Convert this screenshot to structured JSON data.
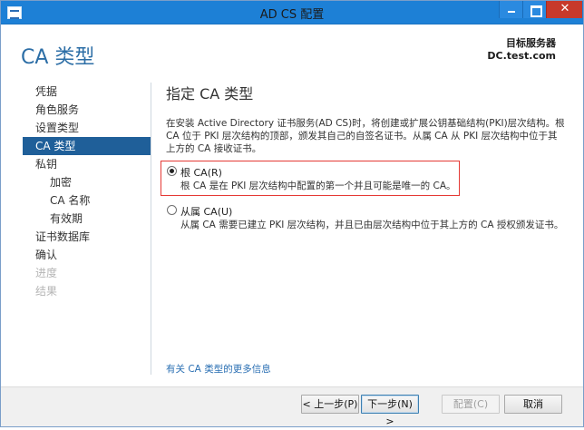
{
  "window": {
    "title": "AD CS 配置",
    "close_glyph": "✕"
  },
  "header": {
    "page_title": "CA 类型",
    "target_server_label": "目标服务器",
    "target_server_value": "DC.test.com"
  },
  "nav": {
    "items": [
      {
        "label": "凭据",
        "state": "normal",
        "level": 0
      },
      {
        "label": "角色服务",
        "state": "normal",
        "level": 0
      },
      {
        "label": "设置类型",
        "state": "normal",
        "level": 0
      },
      {
        "label": "CA 类型",
        "state": "selected",
        "level": 0
      },
      {
        "label": "私钥",
        "state": "normal",
        "level": 0
      },
      {
        "label": "加密",
        "state": "normal",
        "level": 1
      },
      {
        "label": "CA 名称",
        "state": "normal",
        "level": 1
      },
      {
        "label": "有效期",
        "state": "normal",
        "level": 1
      },
      {
        "label": "证书数据库",
        "state": "normal",
        "level": 0
      },
      {
        "label": "确认",
        "state": "normal",
        "level": 0
      },
      {
        "label": "进度",
        "state": "disabled",
        "level": 0
      },
      {
        "label": "结果",
        "state": "disabled",
        "level": 0
      }
    ]
  },
  "content": {
    "section_title": "指定 CA 类型",
    "description": "在安装 Active Directory 证书服务(AD CS)时，将创建或扩展公钥基础结构(PKI)层次结构。根 CA 位于 PKI 层次结构的顶部，颁发其自己的自签名证书。从属 CA 从 PKI 层次结构中位于其上方的 CA 接收证书。",
    "options": {
      "root": {
        "label": "根 CA(R)",
        "description": "根 CA 是在 PKI 层次结构中配置的第一个并且可能是唯一的 CA。",
        "selected": true
      },
      "subordinate": {
        "label": "从属 CA(U)",
        "description": "从属 CA 需要已建立 PKI 层次结构，并且已由层次结构中位于其上方的 CA 授权颁发证书。",
        "selected": false
      }
    },
    "more_info_link": "有关 CA 类型的更多信息"
  },
  "footer": {
    "prev_label": "< 上一步(P)",
    "next_label": "下一步(N) >",
    "configure_label": "配置(C)",
    "cancel_label": "取消"
  },
  "colors": {
    "title_bar": "#1d80d6",
    "accent": "#2c6ea6",
    "nav_selected": "#1f5f99",
    "highlight_border": "#e53935",
    "close_button": "#c7392b"
  }
}
